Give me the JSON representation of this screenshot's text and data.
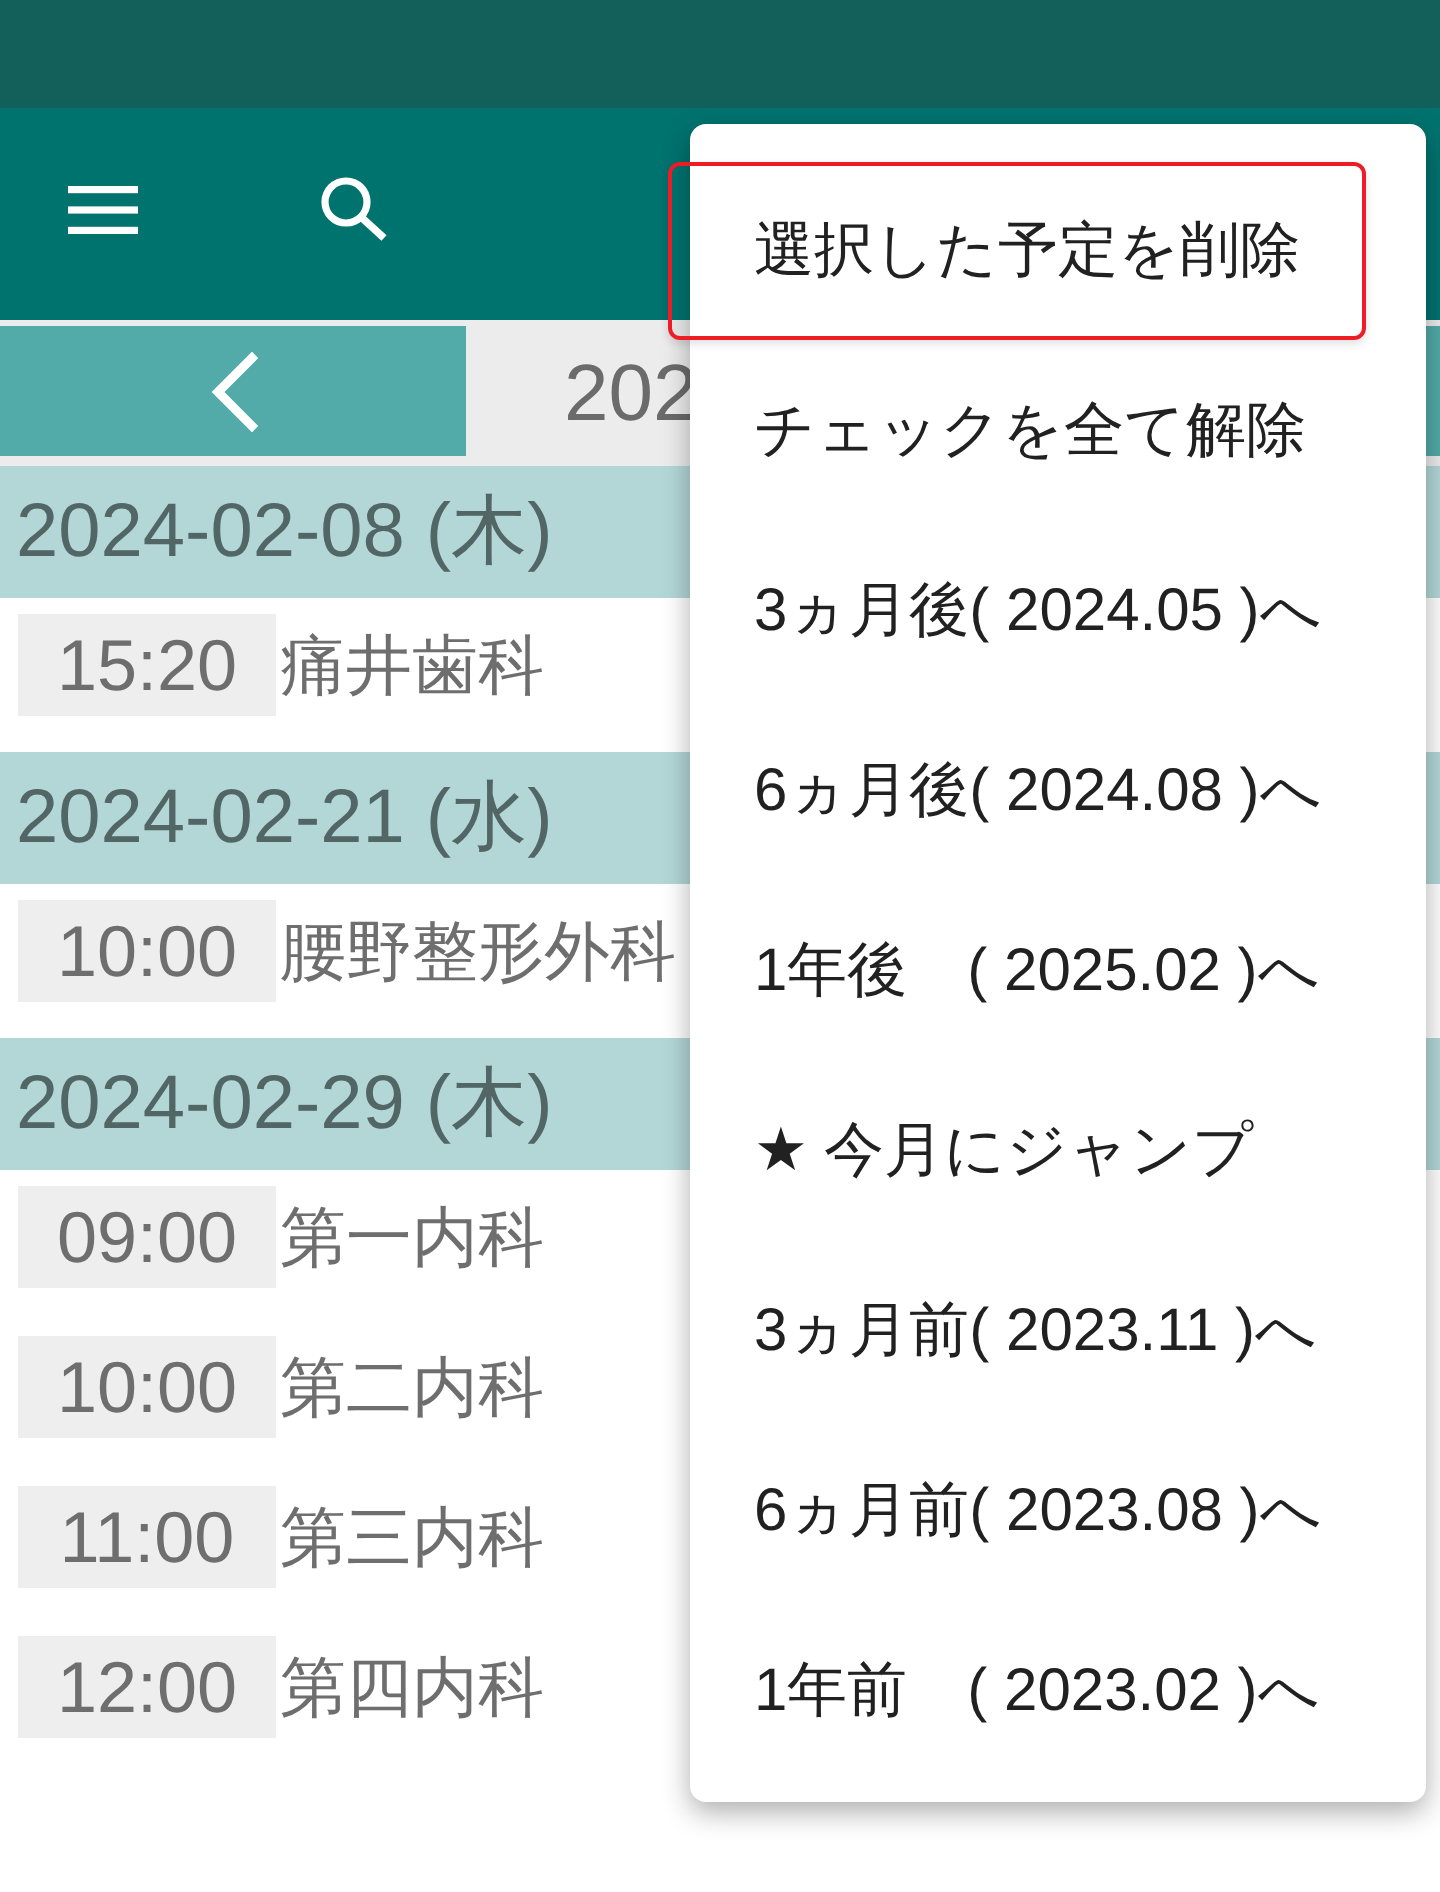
{
  "month_nav": {
    "title": "202"
  },
  "schedule": [
    {
      "date": "2024-02-08 (木)",
      "events": [
        {
          "time": "15:20",
          "name": "痛井歯科"
        }
      ]
    },
    {
      "date": "2024-02-21 (水)",
      "events": [
        {
          "time": "10:00",
          "name": "腰野整形外科"
        }
      ]
    },
    {
      "date": "2024-02-29 (木)",
      "events": [
        {
          "time": "09:00",
          "name": "第一内科"
        },
        {
          "time": "10:00",
          "name": "第二内科"
        },
        {
          "time": "11:00",
          "name": "第三内科"
        },
        {
          "time": "12:00",
          "name": "第四内科"
        }
      ]
    }
  ],
  "menu": {
    "items": [
      {
        "label": "選択した予定を削除",
        "highlighted": true
      },
      {
        "label": "チェックを全て解除",
        "highlighted": false
      },
      {
        "label": "3ヵ月後( 2024.05 )へ",
        "highlighted": false
      },
      {
        "label": "6ヵ月後( 2024.08 )へ",
        "highlighted": false
      },
      {
        "label": "1年後　( 2025.02 )へ",
        "highlighted": false
      },
      {
        "label": "★ 今月にジャンプ",
        "highlighted": false
      },
      {
        "label": "3ヵ月前( 2023.11 )へ",
        "highlighted": false
      },
      {
        "label": "6ヵ月前( 2023.08 )へ",
        "highlighted": false
      },
      {
        "label": "1年前　( 2023.02 )へ",
        "highlighted": false
      }
    ]
  }
}
